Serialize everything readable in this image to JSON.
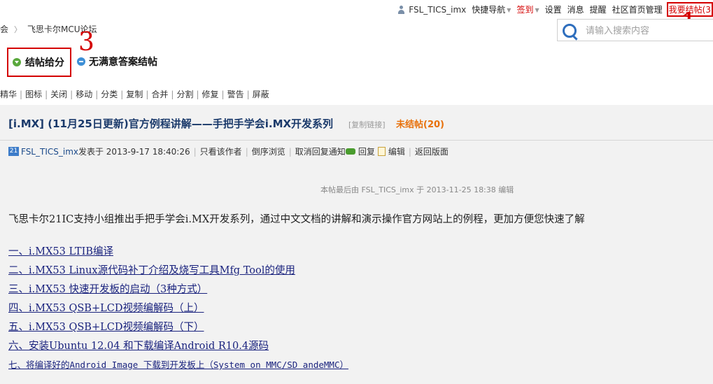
{
  "topnav": {
    "username": "FSL_TICS_imx",
    "quick_nav": "快捷导航",
    "checkin": "签到",
    "settings": "设置",
    "messages": "消息",
    "reminders": "提醒",
    "admin": "社区首页管理",
    "my_close": "我要结帖(3"
  },
  "breadcrumb": {
    "home": "会",
    "forum": "飞思卡尔MCU论坛"
  },
  "search": {
    "placeholder": "请输入搜索内容"
  },
  "annotations": {
    "one": "1",
    "three": "3"
  },
  "actions": {
    "close_reward": "结帖给分",
    "close_unsatisfied": "无满意答案结帖"
  },
  "modbar": [
    "精华",
    "图标",
    "关闭",
    "移动",
    "分类",
    "复制",
    "合并",
    "分割",
    "修复",
    "警告",
    "屏蔽"
  ],
  "thread": {
    "title": "[i.MX] (11月25日更新)官方例程讲解——手把手学会i.MX开发系列",
    "copy_link": "[复制链接]",
    "status": "未结帖(20)"
  },
  "meta": {
    "badge": "21",
    "author": "FSL_TICS_imx",
    "posted": "发表于 2013-9-17 18:40:26",
    "author_only": "只看该作者",
    "reverse": "倒序浏览",
    "cancel_notify": "取消回复通知",
    "reply": "回复",
    "edit": "编辑",
    "back": "返回版面"
  },
  "last_edit": "本帖最后由 FSL_TICS_imx 于 2013-11-25 18:38 编辑",
  "intro": "飞思卡尔21IC支持小组推出手把手学会i.MX开发系列，通过中文文档的讲解和演示操作官方网站上的例程，更加方便您快速了解",
  "links": [
    "一、i.MX53 LTIB编译",
    "二、i.MX53 Linux源代码补丁介绍及烧写工具Mfg Tool的使用",
    "三、i.MX53 快速开发板的启动（3种方式）",
    "四、i.MX53 QSB+LCD视频编解码（上）",
    "五、i.MX53 QSB+LCD视频编解码（下）",
    "六、安装Ubuntu 12.04 和下载编译Android R10.4源码",
    "七、将编译好的Android Image 下载到开发板上（System on MMC/SD andeMMC）"
  ]
}
